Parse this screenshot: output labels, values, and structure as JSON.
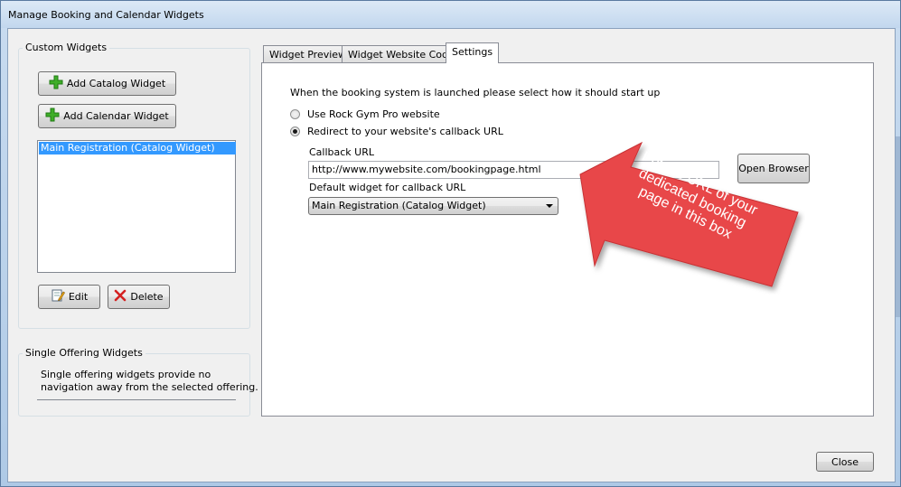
{
  "window": {
    "title": "Manage Booking and Calendar Widgets"
  },
  "custom_widgets": {
    "title": "Custom Widgets",
    "add_catalog_label": "Add Catalog Widget",
    "add_calendar_label": "Add Calendar Widget",
    "list_items": [
      "Main Registration (Catalog Widget)"
    ],
    "edit_label": "Edit",
    "delete_label": "Delete"
  },
  "single_offering": {
    "title": "Single Offering Widgets",
    "description_line1": "Single offering widgets provide no",
    "description_line2": "navigation away from the selected offering."
  },
  "tabs": [
    {
      "label": "Widget Preview",
      "active": false
    },
    {
      "label": "Widget Website Code",
      "active": false
    },
    {
      "label": "Settings",
      "active": true
    }
  ],
  "settings": {
    "prompt": "When the booking system is launched please select how it should start up",
    "option_rgp": "Use Rock Gym Pro website",
    "option_redirect": "Redirect to your website's callback URL",
    "selected_option": "option_redirect",
    "callback_label": "Callback URL",
    "callback_value": "http://www.mywebsite.com/bookingpage.html",
    "open_browser_label": "Open Browser",
    "default_widget_label": "Default widget for callback URL",
    "default_widget_value": "Main Registration (Catalog Widget)"
  },
  "annotation": {
    "text": "Put the URL of your dedicated booking page in this box",
    "color": "#e8474a"
  },
  "footer": {
    "close_label": "Close"
  },
  "icons": {
    "add": "green-plus-icon",
    "edit": "edit-page-icon",
    "delete": "red-x-icon"
  }
}
